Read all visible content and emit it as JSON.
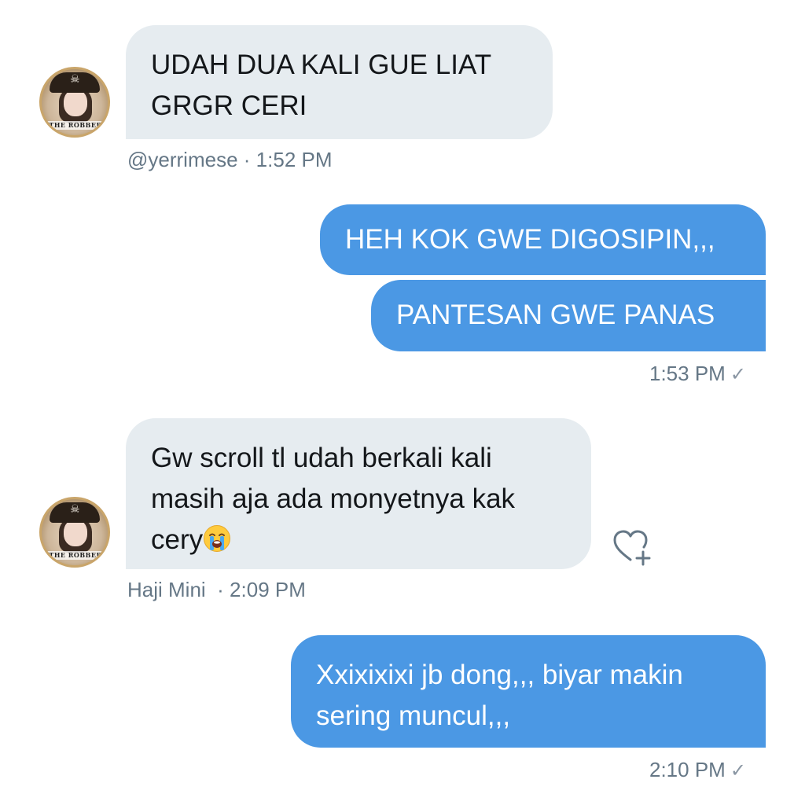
{
  "conversation": {
    "messages": [
      {
        "direction": "incoming",
        "lines": [
          "UDAH DUA KALI GUE LIAT",
          "GRGR CERI"
        ],
        "sender": "@yerrimese",
        "time": "1:52 PM"
      },
      {
        "direction": "outgoing",
        "text": "HEH KOK GWE DIGOSIPIN,,,"
      },
      {
        "direction": "outgoing",
        "text": "PANTESAN GWE PANAS",
        "time": "1:53 PM"
      },
      {
        "direction": "incoming",
        "lines": [
          "Gw scroll tl udah berkali kali",
          "masih aja ada monyetnya kak",
          "cery"
        ],
        "emoji": "loudly-crying-face-emoji",
        "sender": "Haji Mini",
        "time": "2:09 PM"
      },
      {
        "direction": "outgoing",
        "lines": [
          "Xxixixixi jb dong,,, biyar makin",
          "sering muncul,,,"
        ],
        "time": "2:10 PM"
      }
    ],
    "separator": "·",
    "seen_icon": "checkmark-icon",
    "check_glyph": "✓",
    "avatar_band_text": "THE ROBBER",
    "like_icon": "heart-plus-icon"
  },
  "colors": {
    "incoming_bubble": "#e6ecf0",
    "outgoing_bubble": "#4b98e4",
    "meta_text": "#657786"
  }
}
